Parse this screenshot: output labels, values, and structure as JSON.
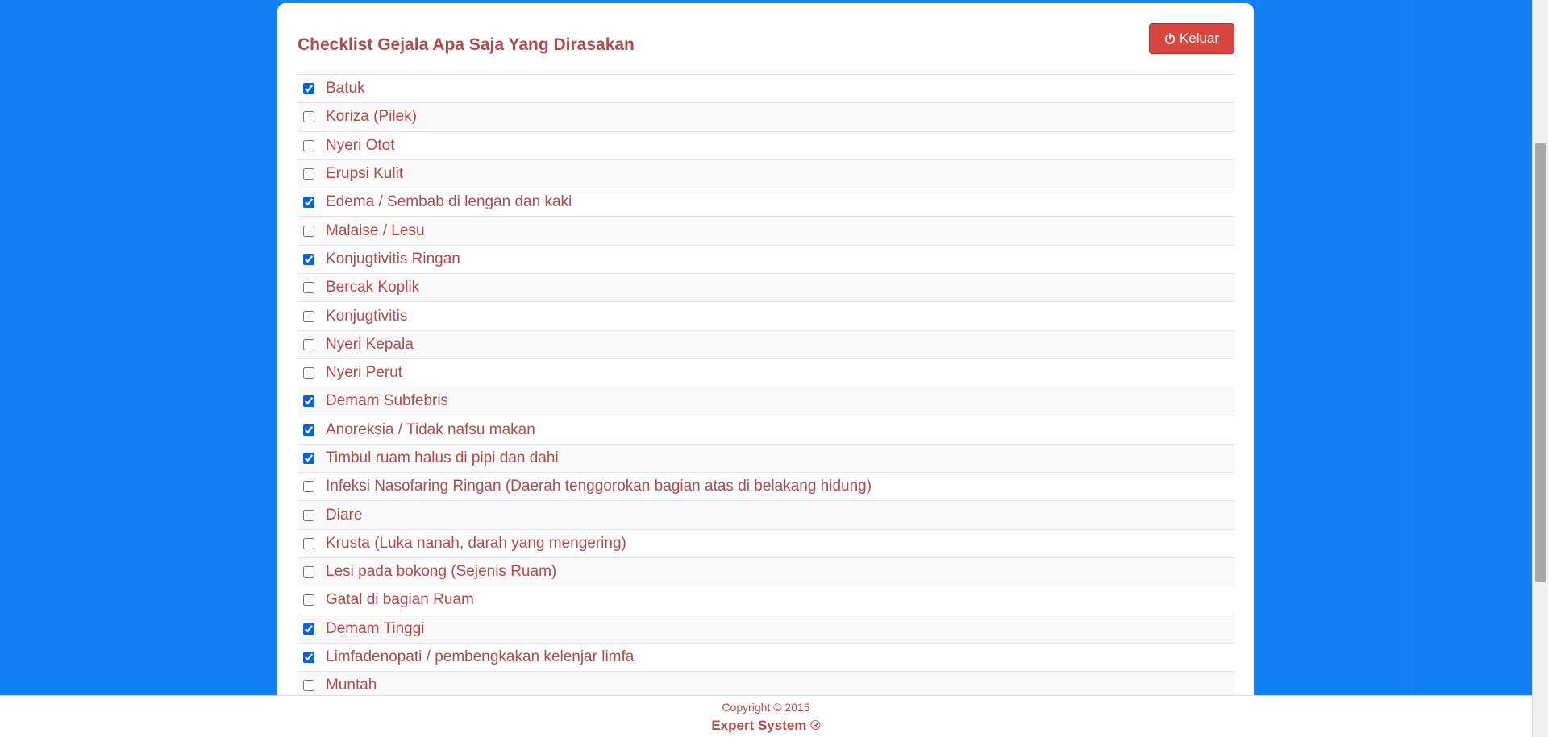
{
  "panel": {
    "title": "Checklist Gejala Apa Saja Yang Dirasakan",
    "logout_label": "Keluar"
  },
  "symptoms": [
    {
      "label": "Batuk",
      "checked": true
    },
    {
      "label": "Koriza (Pilek)",
      "checked": false
    },
    {
      "label": "Nyeri Otot",
      "checked": false
    },
    {
      "label": "Erupsi Kulit",
      "checked": false
    },
    {
      "label": "Edema / Sembab di lengan dan kaki",
      "checked": true
    },
    {
      "label": "Malaise / Lesu",
      "checked": false
    },
    {
      "label": "Konjugtivitis Ringan",
      "checked": true
    },
    {
      "label": "Bercak Koplik",
      "checked": false
    },
    {
      "label": "Konjugtivitis",
      "checked": false
    },
    {
      "label": "Nyeri Kepala",
      "checked": false
    },
    {
      "label": "Nyeri Perut",
      "checked": false
    },
    {
      "label": "Demam Subfebris",
      "checked": true
    },
    {
      "label": "Anoreksia / Tidak nafsu makan",
      "checked": true
    },
    {
      "label": "Timbul ruam halus di pipi dan dahi",
      "checked": true
    },
    {
      "label": "Infeksi Nasofaring Ringan (Daerah tenggorokan bagian atas di belakang hidung)",
      "checked": false
    },
    {
      "label": "Diare",
      "checked": false
    },
    {
      "label": "Krusta (Luka nanah, darah yang mengering)",
      "checked": false
    },
    {
      "label": "Lesi pada bokong (Sejenis Ruam)",
      "checked": false
    },
    {
      "label": "Gatal di bagian Ruam",
      "checked": false
    },
    {
      "label": "Demam Tinggi",
      "checked": true
    },
    {
      "label": "Limfadenopati / pembengkakan kelenjar limfa",
      "checked": true
    },
    {
      "label": "Muntah",
      "checked": false
    }
  ],
  "footer": {
    "copyright": "Copyright © 2015",
    "brand": "Expert System ®"
  },
  "colors": {
    "page_background": "#137ff4",
    "text_accent": "#b14a4a",
    "logout_button": "#d9463f"
  },
  "icons": {
    "logout": "power-icon"
  }
}
